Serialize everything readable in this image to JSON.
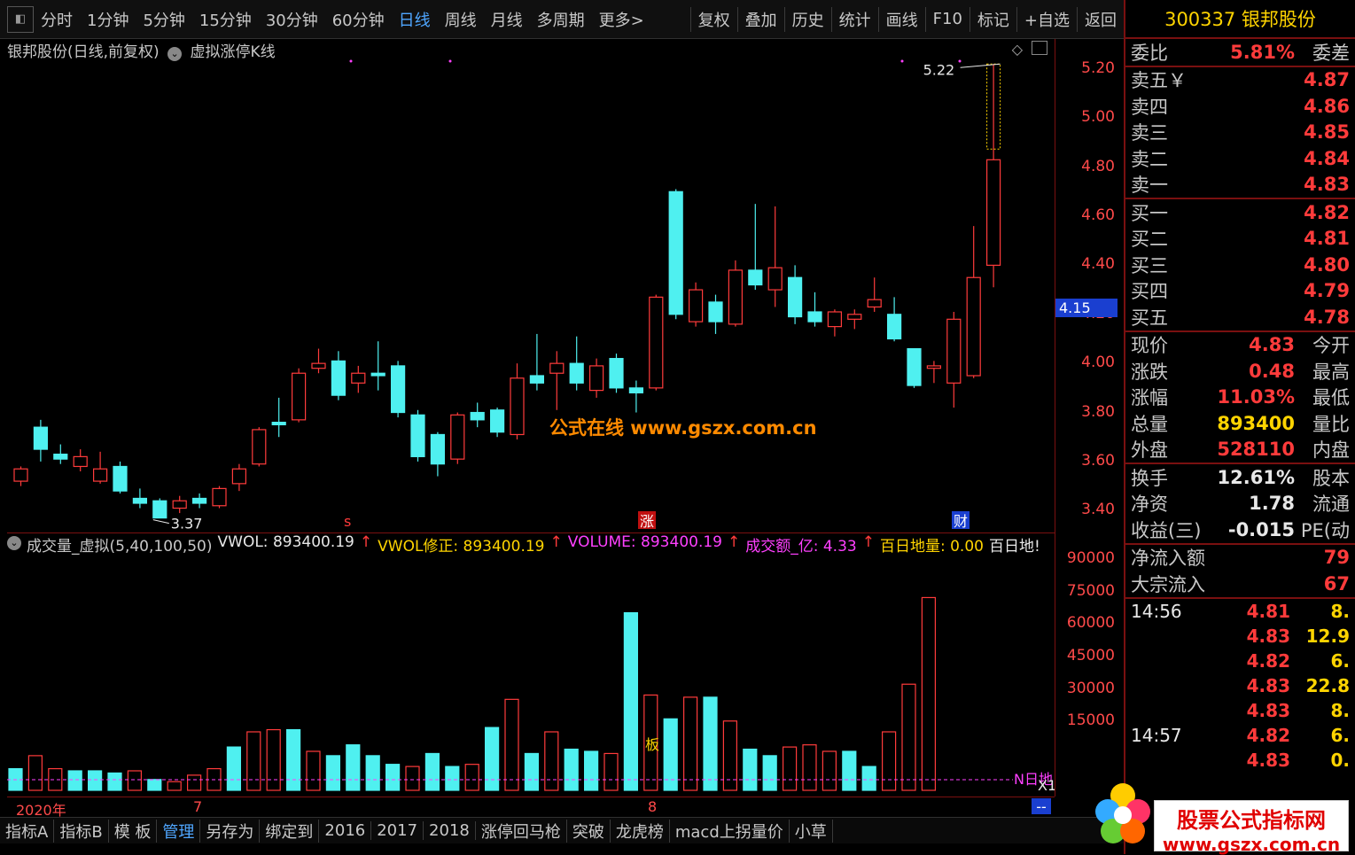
{
  "toolbar": {
    "items": [
      "分时",
      "1分钟",
      "5分钟",
      "15分钟",
      "30分钟",
      "60分钟",
      "日线",
      "周线",
      "月线",
      "多周期",
      "更多>"
    ],
    "active": "日线",
    "right_items": [
      "复权",
      "叠加",
      "历史",
      "统计",
      "画线",
      "F10",
      "标记",
      "+自选",
      "返回"
    ]
  },
  "chart_head": {
    "title": "银邦股份(日线,前复权)",
    "indicator": "虚拟涨停K线"
  },
  "price_labels": {
    "high": "5.22",
    "low": "3.37",
    "current": "4.15"
  },
  "markers": {
    "s": "s",
    "zhang": "涨",
    "cai": "财",
    "ban": "板",
    "ndi": "N日地",
    "x1": "X1"
  },
  "yaxis": [
    "5.20",
    "5.00",
    "4.80",
    "4.60",
    "4.40",
    "4.20",
    "4.00",
    "3.80",
    "3.60",
    "3.40"
  ],
  "vol_yaxis": [
    "90000",
    "75000",
    "60000",
    "45000",
    "30000",
    "15000"
  ],
  "vol_head": {
    "name": "成交量_虚拟(5,40,100,50)",
    "vwol": "VWOL: 893400.19",
    "vwol_fix": "VWOL修正: 893400.19",
    "volume": "VOLUME: 893400.19",
    "amount": "成交额_亿: 4.33",
    "bairi": "百日地量: 0.00",
    "bairi2": "百日地!"
  },
  "date_axis": [
    "2020年",
    "7",
    "8"
  ],
  "bottom_tabs": [
    "指标A",
    "指标B",
    "模 板",
    "管理",
    "另存为",
    "绑定到",
    "2016",
    "2017",
    "2018",
    "涨停回马枪",
    "突破",
    "龙虎榜",
    "macd上拐量价",
    "小草"
  ],
  "bottom_active": "管理",
  "watermark": "公式在线  www.gszx.com.cn",
  "logo": {
    "line1": "股票公式指标网",
    "line2": "www.gszx.com.cn"
  },
  "quote": {
    "title": "300337 银邦股份",
    "weibi": {
      "label": "委比",
      "value": "5.81%",
      "tail": "委差"
    },
    "sells": [
      {
        "label": "卖五￥",
        "value": "4.87"
      },
      {
        "label": "卖四",
        "value": "4.86"
      },
      {
        "label": "卖三",
        "value": "4.85"
      },
      {
        "label": "卖二",
        "value": "4.84"
      },
      {
        "label": "卖一",
        "value": "4.83"
      }
    ],
    "buys": [
      {
        "label": "买一",
        "value": "4.82"
      },
      {
        "label": "买二",
        "value": "4.81"
      },
      {
        "label": "买三",
        "value": "4.80"
      },
      {
        "label": "买四",
        "value": "4.79"
      },
      {
        "label": "买五",
        "value": "4.78"
      }
    ],
    "stats": [
      {
        "label": "现价",
        "value": "4.83",
        "tail": "今开",
        "color": "red"
      },
      {
        "label": "涨跌",
        "value": "0.48",
        "tail": "最高",
        "color": "red"
      },
      {
        "label": "涨幅",
        "value": "11.03%",
        "tail": "最低",
        "color": "red"
      },
      {
        "label": "总量",
        "value": "893400",
        "tail": "量比",
        "color": "yellow"
      },
      {
        "label": "外盘",
        "value": "528110",
        "tail": "内盘",
        "color": "red"
      }
    ],
    "stats2": [
      {
        "label": "换手",
        "value": "12.61%",
        "tail": "股本",
        "color": "white"
      },
      {
        "label": "净资",
        "value": "1.78",
        "tail": "流通",
        "color": "white"
      },
      {
        "label": "收益(三)",
        "value": "-0.015",
        "tail": "PE(动",
        "color": "white"
      }
    ],
    "flow": [
      {
        "label": "净流入额",
        "value": "79"
      },
      {
        "label": "大宗流入",
        "value": "67"
      }
    ],
    "ticks": [
      {
        "time": "14:56",
        "price": "4.81",
        "vol": "8."
      },
      {
        "time": "",
        "price": "4.83",
        "vol": "12.9"
      },
      {
        "time": "",
        "price": "4.82",
        "vol": "6."
      },
      {
        "time": "",
        "price": "4.83",
        "vol": "22.8"
      },
      {
        "time": "",
        "price": "4.83",
        "vol": "8."
      },
      {
        "time": "14:57",
        "price": "4.82",
        "vol": "6."
      },
      {
        "time": "",
        "price": "4.83",
        "vol": "0."
      }
    ]
  },
  "colors": {
    "up": "#ff3b3b",
    "down": "#4ff0f0",
    "bg": "#000000",
    "grid": "#7a1010"
  },
  "chart_data": {
    "type": "candlestick",
    "ylim": [
      3.3,
      5.25
    ],
    "candles": [
      {
        "o": 3.52,
        "c": 3.57,
        "h": 3.58,
        "l": 3.5
      },
      {
        "o": 3.74,
        "c": 3.65,
        "h": 3.77,
        "l": 3.6
      },
      {
        "o": 3.63,
        "c": 3.61,
        "h": 3.67,
        "l": 3.59
      },
      {
        "o": 3.58,
        "c": 3.62,
        "h": 3.65,
        "l": 3.56
      },
      {
        "o": 3.52,
        "c": 3.57,
        "h": 3.64,
        "l": 3.51
      },
      {
        "o": 3.58,
        "c": 3.48,
        "h": 3.6,
        "l": 3.47
      },
      {
        "o": 3.45,
        "c": 3.43,
        "h": 3.49,
        "l": 3.41
      },
      {
        "o": 3.44,
        "c": 3.37,
        "h": 3.45,
        "l": 3.37
      },
      {
        "o": 3.41,
        "c": 3.44,
        "h": 3.46,
        "l": 3.39
      },
      {
        "o": 3.45,
        "c": 3.43,
        "h": 3.47,
        "l": 3.41
      },
      {
        "o": 3.42,
        "c": 3.49,
        "h": 3.5,
        "l": 3.41
      },
      {
        "o": 3.51,
        "c": 3.57,
        "h": 3.59,
        "l": 3.48
      },
      {
        "o": 3.59,
        "c": 3.73,
        "h": 3.74,
        "l": 3.58
      },
      {
        "o": 3.76,
        "c": 3.75,
        "h": 3.86,
        "l": 3.7
      },
      {
        "o": 3.77,
        "c": 3.96,
        "h": 3.98,
        "l": 3.76
      },
      {
        "o": 3.98,
        "c": 4.0,
        "h": 4.06,
        "l": 3.96
      },
      {
        "o": 4.01,
        "c": 3.87,
        "h": 4.05,
        "l": 3.85
      },
      {
        "o": 3.92,
        "c": 3.96,
        "h": 3.99,
        "l": 3.88
      },
      {
        "o": 3.96,
        "c": 3.95,
        "h": 4.09,
        "l": 3.89
      },
      {
        "o": 3.99,
        "c": 3.8,
        "h": 4.01,
        "l": 3.78
      },
      {
        "o": 3.79,
        "c": 3.62,
        "h": 3.81,
        "l": 3.6
      },
      {
        "o": 3.71,
        "c": 3.59,
        "h": 3.72,
        "l": 3.54
      },
      {
        "o": 3.61,
        "c": 3.79,
        "h": 3.8,
        "l": 3.59
      },
      {
        "o": 3.8,
        "c": 3.77,
        "h": 3.84,
        "l": 3.74
      },
      {
        "o": 3.81,
        "c": 3.72,
        "h": 3.82,
        "l": 3.7
      },
      {
        "o": 3.71,
        "c": 3.94,
        "h": 4.0,
        "l": 3.69
      },
      {
        "o": 3.95,
        "c": 3.92,
        "h": 4.12,
        "l": 3.89
      },
      {
        "o": 3.96,
        "c": 4.0,
        "h": 4.05,
        "l": 3.81
      },
      {
        "o": 4.0,
        "c": 3.92,
        "h": 4.11,
        "l": 3.89
      },
      {
        "o": 3.89,
        "c": 3.99,
        "h": 4.02,
        "l": 3.86
      },
      {
        "o": 4.02,
        "c": 3.9,
        "h": 4.04,
        "l": 3.88
      },
      {
        "o": 3.9,
        "c": 3.88,
        "h": 3.93,
        "l": 3.8
      },
      {
        "o": 3.9,
        "c": 4.27,
        "h": 4.28,
        "l": 3.89
      },
      {
        "o": 4.7,
        "c": 4.2,
        "h": 4.71,
        "l": 4.18
      },
      {
        "o": 4.17,
        "c": 4.3,
        "h": 4.33,
        "l": 4.15
      },
      {
        "o": 4.25,
        "c": 4.17,
        "h": 4.28,
        "l": 4.12
      },
      {
        "o": 4.16,
        "c": 4.38,
        "h": 4.42,
        "l": 4.15
      },
      {
        "o": 4.38,
        "c": 4.32,
        "h": 4.65,
        "l": 4.3
      },
      {
        "o": 4.3,
        "c": 4.39,
        "h": 4.64,
        "l": 4.23
      },
      {
        "o": 4.35,
        "c": 4.19,
        "h": 4.4,
        "l": 4.16
      },
      {
        "o": 4.21,
        "c": 4.17,
        "h": 4.29,
        "l": 4.15
      },
      {
        "o": 4.15,
        "c": 4.21,
        "h": 4.22,
        "l": 4.11
      },
      {
        "o": 4.18,
        "c": 4.2,
        "h": 4.22,
        "l": 4.14
      },
      {
        "o": 4.23,
        "c": 4.26,
        "h": 4.35,
        "l": 4.21
      },
      {
        "o": 4.2,
        "c": 4.1,
        "h": 4.27,
        "l": 4.09
      },
      {
        "o": 4.06,
        "c": 3.91,
        "h": 4.06,
        "l": 3.9
      },
      {
        "o": 3.98,
        "c": 3.99,
        "h": 4.01,
        "l": 3.92
      },
      {
        "o": 3.92,
        "c": 4.18,
        "h": 4.21,
        "l": 3.82
      },
      {
        "o": 3.95,
        "c": 4.35,
        "h": 4.56,
        "l": 3.94
      },
      {
        "o": 4.4,
        "c": 4.83,
        "h": 5.22,
        "l": 4.31
      }
    ],
    "volumes": [
      10,
      16,
      10,
      9,
      9,
      8,
      9,
      5,
      4,
      7,
      10,
      20,
      27,
      28,
      28,
      18,
      16,
      21,
      16,
      12,
      11,
      17,
      11,
      12,
      29,
      42,
      17,
      27,
      19,
      18,
      17,
      82,
      44,
      33,
      43,
      43,
      32,
      19,
      16,
      20,
      21,
      18,
      18,
      11,
      27,
      49,
      89
    ]
  }
}
